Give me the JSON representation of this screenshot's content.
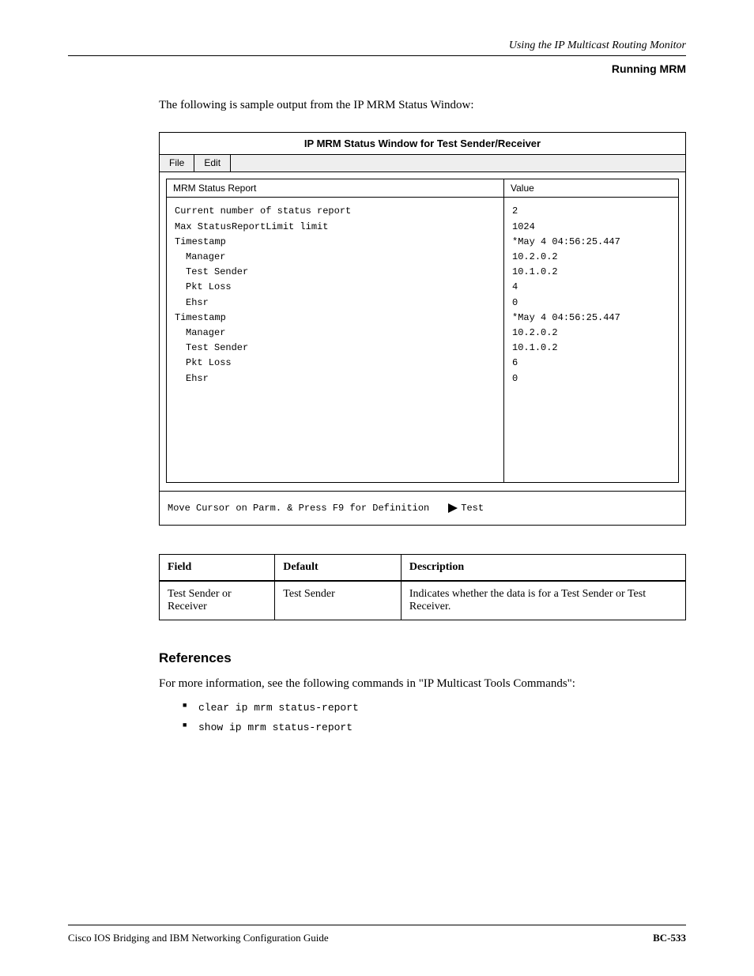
{
  "header": {
    "section": "Using the IP Multicast Routing Monitor",
    "subtitle": "Running MRM"
  },
  "intro": "The following is sample output from the IP MRM Status Window:",
  "window": {
    "title": "IP MRM Status Window for Test Sender/Receiver",
    "tabs": [
      "File",
      "Edit"
    ],
    "columns": [
      "MRM Status Report",
      "Value"
    ],
    "rows": [
      [
        "Current number of status report",
        "2"
      ],
      [
        "Max StatusReportLimit limit",
        "1024"
      ],
      [
        "Timestamp",
        "*May  4 04:56:25.447"
      ],
      [
        "Manager",
        "10.2.0.2"
      ],
      [
        "Test Sender",
        "10.1.0.2"
      ],
      [
        "Pkt Loss",
        "4"
      ],
      [
        "Ehsr",
        "0"
      ],
      [
        "Timestamp",
        "*May  4 04:56:25.447"
      ],
      [
        "Manager",
        "10.2.0.2"
      ],
      [
        "Test Sender",
        "10.1.0.2"
      ],
      [
        "Pkt Loss",
        "6"
      ],
      [
        "Ehsr",
        "0"
      ]
    ],
    "status": "Move Cursor on Parm. & Press F9 for Definition",
    "test_label": "Test"
  },
  "defs": {
    "headers": [
      "Field",
      "Default",
      "Description"
    ],
    "row": [
      "Test Sender or Receiver",
      "Test Sender",
      "Indicates whether the data is for a Test Sender or Test Receiver."
    ]
  },
  "references": {
    "heading": "References",
    "text": "For more information, see the following commands in \"IP Multicast Tools Commands\":",
    "items": [
      "clear ip mrm status-report",
      "show ip mrm status-report"
    ]
  },
  "footer": {
    "left": "Cisco IOS Bridging and IBM Networking Configuration Guide",
    "right": "BC-533"
  }
}
